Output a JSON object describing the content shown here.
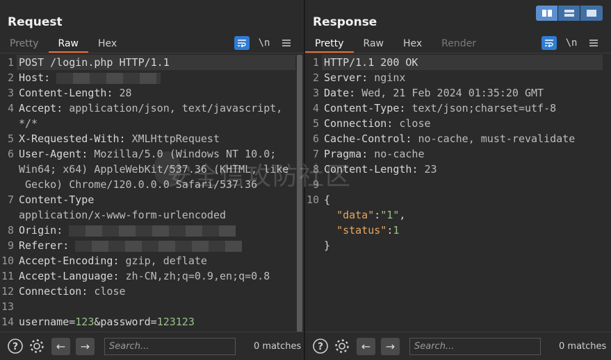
{
  "request": {
    "title": "Request",
    "tabs": [
      "Pretty",
      "Raw",
      "Hex"
    ],
    "active_tab": "Raw",
    "icons": [
      "wrap-icon",
      "newline-icon",
      "menu-icon"
    ],
    "newline_label": "\\n",
    "lines": [
      {
        "n": "1",
        "key": "POST /login.php HTTP/1.1",
        "val": ""
      },
      {
        "n": "2",
        "key": "Host",
        "val": ""
      },
      {
        "n": "3",
        "key": "Content-Length",
        "val": "28"
      },
      {
        "n": "4",
        "key": "Accept",
        "val": "application/json, text/javascript,"
      },
      {
        "n": "",
        "key": "",
        "val": "*/*"
      },
      {
        "n": "5",
        "key": "X-Requested-With",
        "val": "XMLHttpRequest"
      },
      {
        "n": "6",
        "key": "User-Agent",
        "val": "Mozilla/5.0 (Windows NT 10.0;"
      },
      {
        "n": "",
        "key": "",
        "val": "Win64; x64) AppleWebKit/537.36 (KHTML, like"
      },
      {
        "n": "",
        "key": "",
        "val": " Gecko) Chrome/120.0.0.0 Safari/537.36"
      },
      {
        "n": "7",
        "key": "Content-Type",
        "val": ""
      },
      {
        "n": "",
        "key": "",
        "val": "application/x-www-form-urlencoded"
      },
      {
        "n": "8",
        "key": "Origin",
        "val": ""
      },
      {
        "n": "9",
        "key": "Referer",
        "val": ""
      },
      {
        "n": "10",
        "key": "Accept-Encoding",
        "val": "gzip, deflate"
      },
      {
        "n": "11",
        "key": "Accept-Language",
        "val": "zh-CN,zh;q=0.9,en;q=0.8"
      },
      {
        "n": "12",
        "key": "Connection",
        "val": "close"
      },
      {
        "n": "13",
        "key": "",
        "val": ""
      },
      {
        "n": "14",
        "key": "",
        "val": ""
      }
    ],
    "body": {
      "p1": "username",
      "v1": "123",
      "amp": "&",
      "p2": "password",
      "v2": "123123"
    },
    "search_placeholder": "Search...",
    "matches": "0 matches"
  },
  "response": {
    "title": "Response",
    "tabs": [
      "Pretty",
      "Raw",
      "Hex",
      "Render"
    ],
    "active_tab": "Pretty",
    "newline_label": "\\n",
    "lines": [
      {
        "n": "1",
        "key": "HTTP/1.1 200 OK",
        "val": ""
      },
      {
        "n": "2",
        "key": "Server",
        "val": "nginx"
      },
      {
        "n": "3",
        "key": "Date",
        "val": "Wed, 21 Feb 2024 01:35:20 GMT"
      },
      {
        "n": "4",
        "key": "Content-Type",
        "val": "text/json;charset=utf-8"
      },
      {
        "n": "5",
        "key": "Connection",
        "val": "close"
      },
      {
        "n": "6",
        "key": "Cache-Control",
        "val": "no-cache, must-revalidate"
      },
      {
        "n": "7",
        "key": "Pragma",
        "val": "no-cache"
      },
      {
        "n": "8",
        "key": "Content-Length",
        "val": "23"
      },
      {
        "n": "9",
        "key": "",
        "val": ""
      }
    ],
    "json": {
      "open": "{",
      "k1": "\"data\"",
      "v1": "\"1\"",
      "k2": "\"status\"",
      "v2": "1",
      "close": "}"
    },
    "search_placeholder": "Search...",
    "matches": "0 matches"
  },
  "watermark": "安全信攻防社区",
  "colors": {
    "accent_tab": "#e8703a",
    "blue_button": "#2f7cd3",
    "string": "#e7a663",
    "number": "#9bc28a"
  }
}
